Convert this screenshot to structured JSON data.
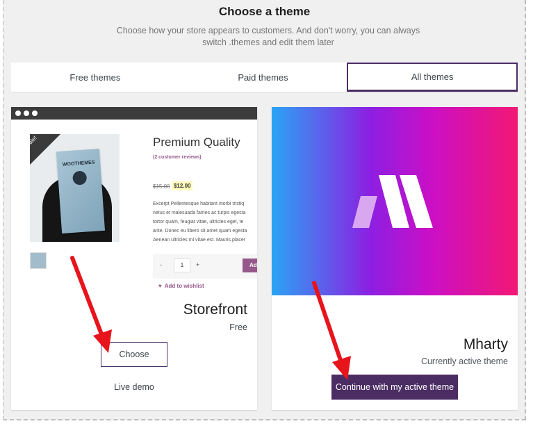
{
  "header": {
    "title": "Choose a theme",
    "subtitle": "Choose how your store appears to customers. And don't worry, you can always switch .themes and edit them later"
  },
  "tabs": [
    {
      "label": "Free themes",
      "active": false
    },
    {
      "label": "Paid themes",
      "active": false
    },
    {
      "label": "All themes",
      "active": true
    }
  ],
  "themes": [
    {
      "name": "Storefront",
      "price": "Free",
      "primary_action": "Choose",
      "secondary_action": "Live demo",
      "preview": {
        "sale_badge": "Sale!",
        "poster_text": "WOOTHEMES",
        "product_title": "Premium Quality",
        "reviews": "(2 customer reviews)",
        "price_old": "$15.00",
        "price_new": "$12.00",
        "excerpt_lines": [
          "Excerpt Pellentesque habitant morbi tristiq",
          "netus et malesuada fames ac turpis egesta",
          "tortor quam, feugiat vitae, ultricies eget, te",
          "ante. Donec eu libero sit amet quam egesta",
          "Aenean ultricies mi vitae est. Mauris placer"
        ],
        "qty_minus": "-",
        "qty_value": "1",
        "qty_plus": "+",
        "add_button": "Ad",
        "wishlist": "Add to wishlist"
      }
    },
    {
      "name": "Mharty",
      "status": "Currently active theme",
      "primary_action": "Continue with my active theme"
    }
  ],
  "colors": {
    "accent": "#4b2d64",
    "woo_purple": "#96588a",
    "annotation_arrow": "#e8141c",
    "background": "#f0f0f1"
  }
}
